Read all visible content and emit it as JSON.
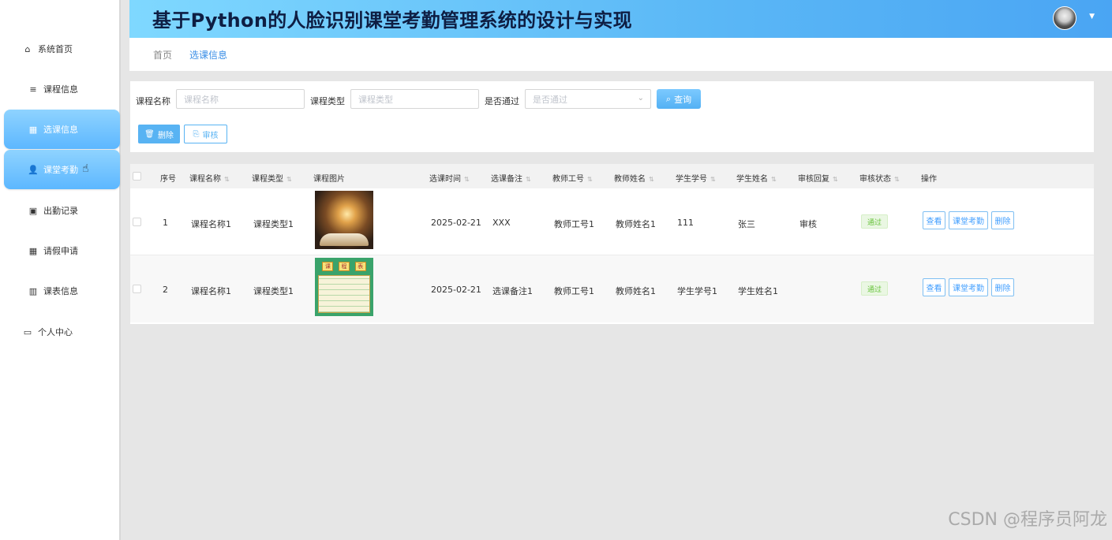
{
  "header": {
    "title": "基于Python的人脸识别课堂考勤管理系统的设计与实现"
  },
  "sidebar": {
    "items": [
      {
        "label": "系统首页",
        "icon": "home-icon"
      },
      {
        "label": "课程信息",
        "icon": "list-icon"
      },
      {
        "label": "选课信息",
        "icon": "grid-icon"
      },
      {
        "label": "课堂考勤",
        "icon": "user-icon"
      },
      {
        "label": "出勤记录",
        "icon": "clipboard-icon"
      },
      {
        "label": "请假申请",
        "icon": "grid-icon"
      },
      {
        "label": "课表信息",
        "icon": "table-icon"
      },
      {
        "label": "个人中心",
        "icon": "card-icon"
      }
    ]
  },
  "breadcrumb": {
    "home": "首页",
    "current": "选课信息"
  },
  "search": {
    "course_name_label": "课程名称",
    "course_name_placeholder": "课程名称",
    "course_type_label": "课程类型",
    "course_type_placeholder": "课程类型",
    "passed_label": "是否通过",
    "passed_placeholder": "是否通过",
    "query_label": "查询",
    "delete_label": "删除",
    "audit_label": "审核"
  },
  "table": {
    "columns": [
      "序号",
      "课程名称",
      "课程类型",
      "课程图片",
      "选课时间",
      "选课备注",
      "教师工号",
      "教师姓名",
      "学生学号",
      "学生姓名",
      "审核回复",
      "审核状态",
      "操作"
    ],
    "rows": [
      {
        "index": "1",
        "course_name": "课程名称1",
        "course_type": "课程类型1",
        "select_time": "2025-02-21",
        "remark": "XXX",
        "teacher_id": "教师工号1",
        "teacher_name": "教师姓名1",
        "student_id": "111",
        "student_name": "张三",
        "reply": "审核",
        "status": "通过"
      },
      {
        "index": "2",
        "course_name": "课程名称1",
        "course_type": "课程类型1",
        "select_time": "2025-02-21",
        "remark": "选课备注1",
        "teacher_id": "教师工号1",
        "teacher_name": "教师姓名1",
        "student_id": "学生学号1",
        "student_name": "学生姓名1",
        "reply": "",
        "status": "通过"
      }
    ],
    "thumb2_header": [
      "课",
      "程",
      "表"
    ],
    "actions": {
      "view": "查看",
      "attendance": "课堂考勤",
      "delete": "删除"
    }
  },
  "watermark": "CSDN @程序员阿龙",
  "colors": {
    "accent": "#409eff",
    "header_gradient_start": "#7fd8ff",
    "header_gradient_end": "#4aa5f3",
    "success": "#67c23a"
  }
}
